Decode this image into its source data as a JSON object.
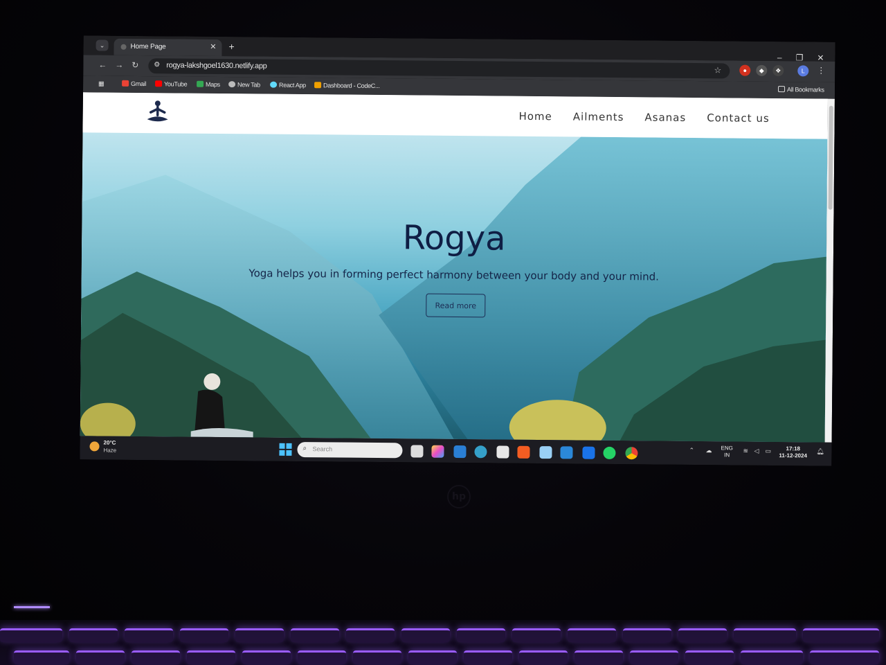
{
  "browser": {
    "tab_title": "Home Page",
    "url": "rogya-lakshgoel1630.netlify.app",
    "bookmarks": [
      "Gmail",
      "YouTube",
      "Maps",
      "New Tab",
      "React App",
      "Dashboard - CodeC...",
      "All Bookmarks"
    ]
  },
  "site": {
    "nav": [
      "Home",
      "Ailments",
      "Asanas",
      "Contact us"
    ],
    "hero_title": "Rogya",
    "hero_subtitle": "Yoga helps you in forming perfect harmony between your body and your mind.",
    "cta_label": "Read more"
  },
  "taskbar": {
    "temperature": "20°C",
    "condition": "Haze",
    "search_placeholder": "Search",
    "lang_1": "ENG",
    "lang_2": "IN",
    "time": "17:18",
    "date": "11-12-2024"
  },
  "colors": {
    "hero_text": "#0f1e44",
    "chrome_dark": "#35363a"
  }
}
